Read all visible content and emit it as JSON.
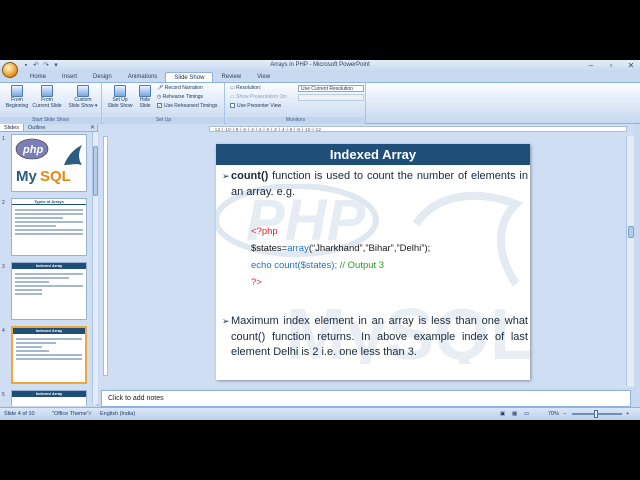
{
  "window": {
    "title": "Arrays in  PHP - Microsoft PowerPoint",
    "controls": [
      "–",
      "▫",
      "✕"
    ]
  },
  "quick_access": [
    "save-icon",
    "undo-icon",
    "redo-icon",
    "print-icon"
  ],
  "tabs": [
    {
      "label": "Home"
    },
    {
      "label": "Insert"
    },
    {
      "label": "Design"
    },
    {
      "label": "Animations"
    },
    {
      "label": "Slide Show",
      "active": true
    },
    {
      "label": "Review"
    },
    {
      "label": "View"
    }
  ],
  "ribbon": {
    "start": {
      "from_beginning": "From\nBeginning",
      "from_current": "From\nCurrent Slide",
      "custom": "Custom\nSlide Show ▾",
      "label": "Start Slide Show"
    },
    "setup": {
      "setup_show": "Set Up\nSlide Show",
      "hide_slide": "Hide\nSlide",
      "record": "Record Narration",
      "rehearse": "Rehearse Timings",
      "use_rehearsed": "Use Rehearsed Timings",
      "label": "Set Up"
    },
    "monitors": {
      "resolution_label": "Resolution:",
      "resolution_value": "Use Current Resolution",
      "show_on_label": "Show Presentation On:",
      "presenter_view": "Use Presenter View",
      "label": "Monitors"
    }
  },
  "left_pane": {
    "tabs": [
      "Slides",
      "Outline"
    ],
    "close": "✕",
    "thumbs": [
      {
        "num": "1",
        "title": ""
      },
      {
        "num": "2",
        "title": "Types of Arrays"
      },
      {
        "num": "3",
        "title": "Indexed Array"
      },
      {
        "num": "4",
        "title": "Indexed Array"
      },
      {
        "num": "5",
        "title": "Indexed Array"
      }
    ]
  },
  "ruler_text": "·12·l·10·l·8·l·6·l·4·l·2·l·0·l·2·l·4·l·6·l·8·l·10·l·12·",
  "slide": {
    "title": "Indexed Array",
    "bullet1_bold": "count()",
    "bullet1_rest": " function is used to count the number of elements in an array. e.g.",
    "code": {
      "open": "<?php",
      "line2_var": "$states=",
      "line2_fn": "array",
      "line2_args": "(“Jharkhand”,”Bihar”,”Delhi”);",
      "line3_code": "echo count",
      "line3_arg": "($states);",
      "line3_comment": " // Output 3",
      "close": "?>"
    },
    "bullet2": "Maximum index element in an array is less than one what count() function returns. In above example index of last element Delhi is 2 i.e. one less than 3."
  },
  "notes_placeholder": "Click to add notes",
  "status": {
    "slide": "Slide 4 of 10",
    "theme": "\"Office Theme\"",
    "language": "English (India)",
    "zoom": "70%"
  }
}
